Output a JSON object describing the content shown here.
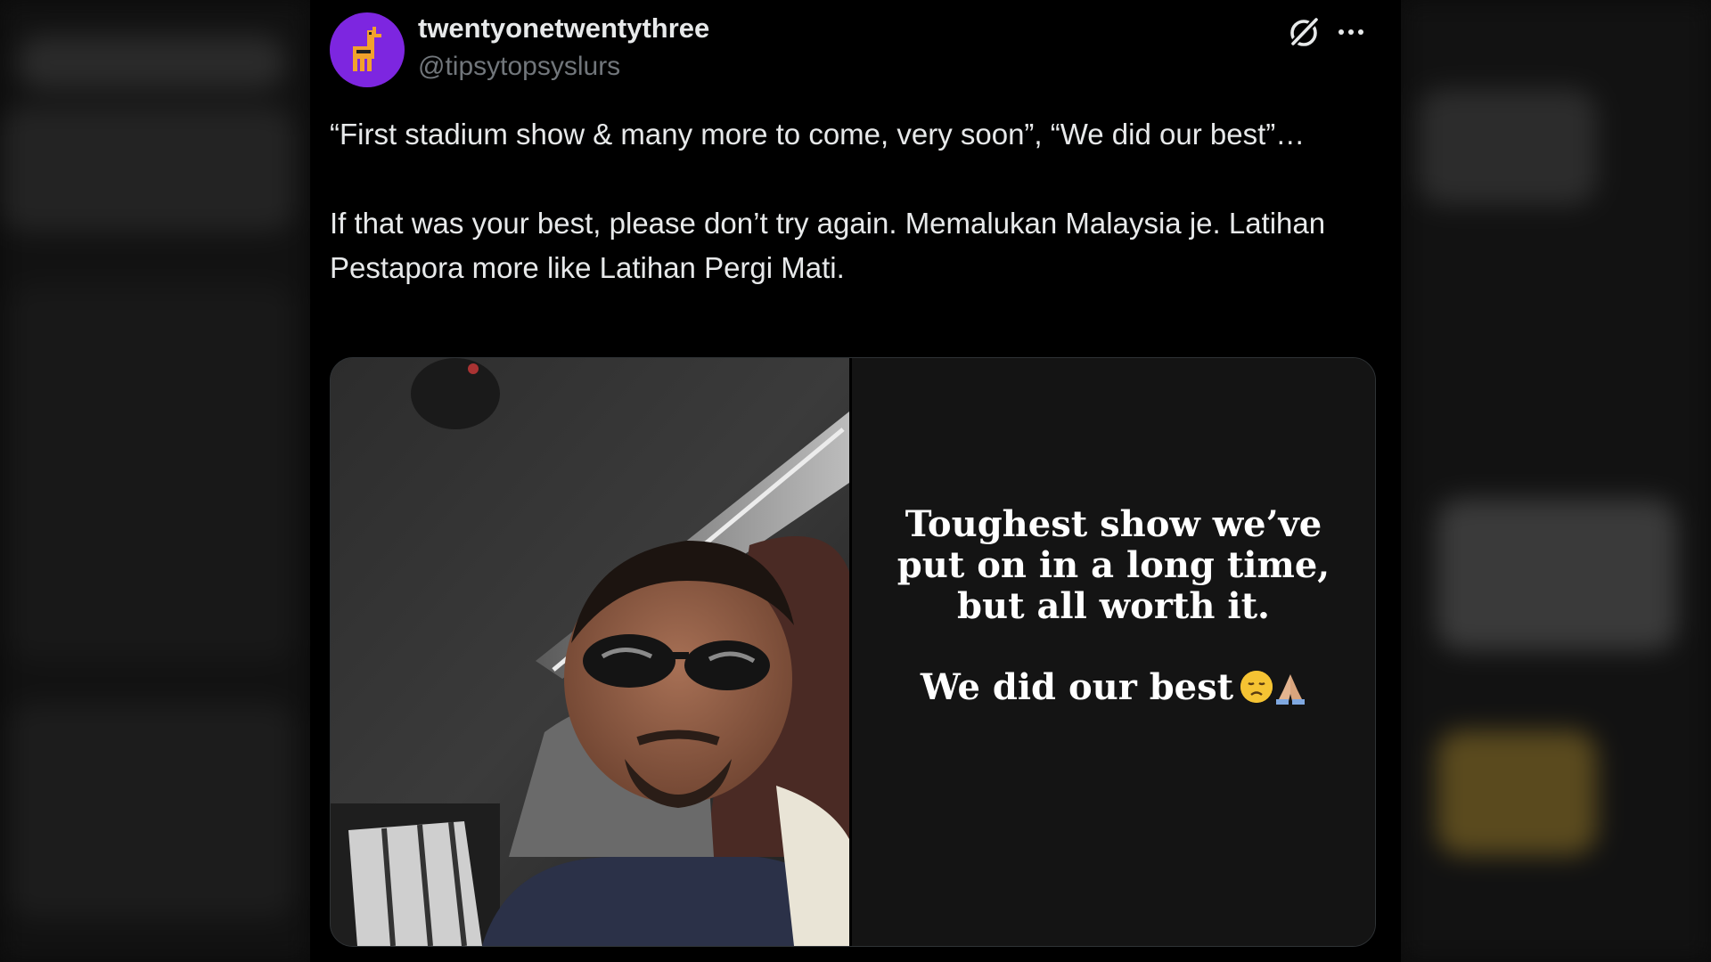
{
  "tweet": {
    "display_name": "twentyonetwentythree",
    "handle": "@tipsytopsyslurs",
    "text_paragraph_1": "“First stadium show & many more to come, very soon”, “We did our best”…",
    "text_paragraph_2": "If that was your best, please don’t try again. Memalukan Malaysia je. Latihan Pestapora more like Latihan Pergi Mati."
  },
  "media": {
    "story_text_main": "Toughest show we’ve put on in a long time, but all worth it.",
    "story_text_second": "We did our best",
    "story_emojis": [
      "disappointed-face",
      "folded-hands"
    ]
  },
  "icons": {
    "header_actions": [
      "grok-icon",
      "more-icon"
    ]
  },
  "colors": {
    "avatar_bg": "#7d26e0",
    "text_primary": "#e7e9ea",
    "text_secondary": "#71767b",
    "background": "#000000"
  }
}
